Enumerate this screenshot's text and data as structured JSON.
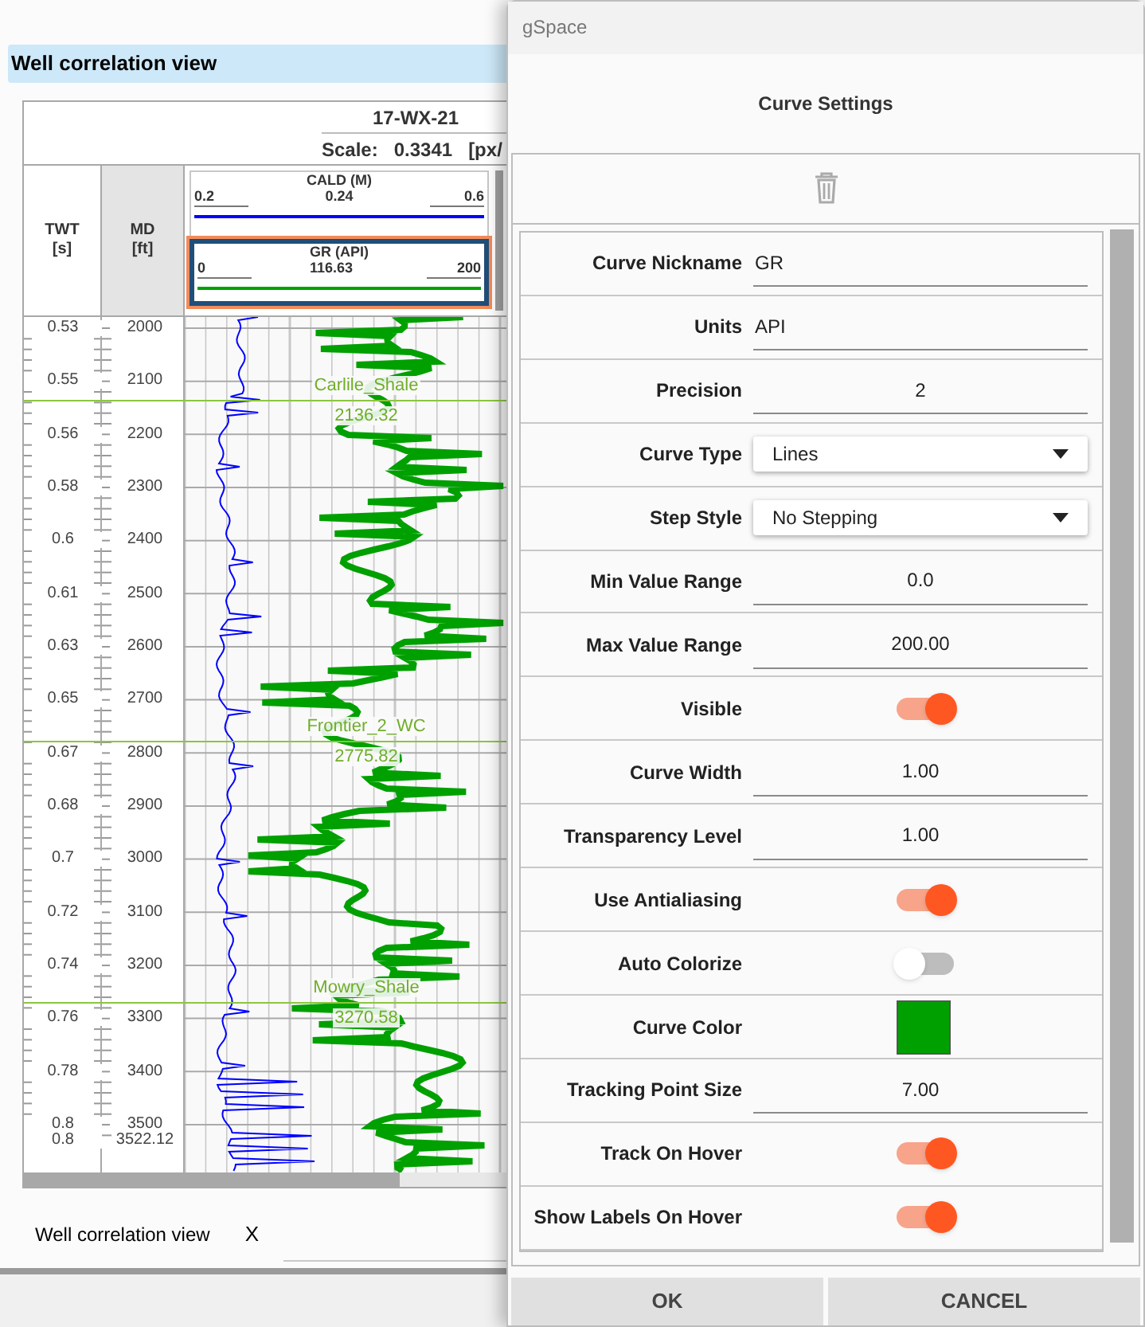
{
  "main_window": {
    "view_title": "Well correlation view",
    "well_name": "17-WX-21",
    "scale_label": "Scale:",
    "scale_value": "0.3341",
    "scale_unit": "[px/",
    "twt_header": {
      "name": "TWT",
      "unit": "[s]"
    },
    "md_header": {
      "name": "MD",
      "unit": "[ft]"
    },
    "curves": [
      {
        "name": "CALD (M)",
        "min": "0.2",
        "current": "0.24",
        "max": "0.6",
        "color": "#0000ff",
        "selected": false
      },
      {
        "name": "GR (API)",
        "min": "0",
        "current": "116.63",
        "max": "200",
        "color": "#00a000",
        "selected": true
      }
    ],
    "depth_labels": [
      {
        "twt": "0.53",
        "md": "2000"
      },
      {
        "twt": "0.55",
        "md": "2100"
      },
      {
        "twt": "0.56",
        "md": "2200"
      },
      {
        "twt": "0.58",
        "md": "2300"
      },
      {
        "twt": "0.6",
        "md": "2400"
      },
      {
        "twt": "0.61",
        "md": "2500"
      },
      {
        "twt": "0.63",
        "md": "2600"
      },
      {
        "twt": "0.65",
        "md": "2700"
      },
      {
        "twt": "0.67",
        "md": "2800"
      },
      {
        "twt": "0.68",
        "md": "2900"
      },
      {
        "twt": "0.7",
        "md": "3000"
      },
      {
        "twt": "0.72",
        "md": "3100"
      },
      {
        "twt": "0.74",
        "md": "3200"
      },
      {
        "twt": "0.76",
        "md": "3300"
      },
      {
        "twt": "0.78",
        "md": "3400"
      },
      {
        "twt": "0.8",
        "md": "3500"
      },
      {
        "twt": "0.8",
        "md": "3522.12"
      }
    ],
    "formation_tops": [
      {
        "name": "Carlile_Shale",
        "depth": "2136.32"
      },
      {
        "name": "Frontier_2_WC",
        "depth": "2775.82"
      },
      {
        "name": "Mowry_Shale",
        "depth": "3270.58"
      }
    ],
    "tabs": [
      {
        "label": "Well correlation view",
        "close": "X",
        "selected": true
      }
    ]
  },
  "dialog": {
    "app_title": "gSpace",
    "title": "Curve Settings",
    "rows": [
      {
        "kind": "text",
        "label": "Curve Nickname",
        "value": "GR"
      },
      {
        "kind": "text",
        "label": "Units",
        "value": "API"
      },
      {
        "kind": "number",
        "label": "Precision",
        "value": "2"
      },
      {
        "kind": "select",
        "label": "Curve Type",
        "value": "Lines"
      },
      {
        "kind": "select",
        "label": "Step Style",
        "value": "No Stepping"
      },
      {
        "kind": "number",
        "label": "Min Value Range",
        "value": "0.0"
      },
      {
        "kind": "number",
        "label": "Max Value Range",
        "value": "200.00"
      },
      {
        "kind": "toggle",
        "label": "Visible",
        "on": true
      },
      {
        "kind": "number",
        "label": "Curve Width",
        "value": "1.00"
      },
      {
        "kind": "number",
        "label": "Transparency Level",
        "value": "1.00"
      },
      {
        "kind": "toggle",
        "label": "Use Antialiasing",
        "on": true
      },
      {
        "kind": "toggle",
        "label": "Auto Colorize",
        "on": false
      },
      {
        "kind": "color",
        "label": "Curve Color",
        "color": "#00a000"
      },
      {
        "kind": "number",
        "label": "Tracking Point Size",
        "value": "7.00"
      },
      {
        "kind": "toggle",
        "label": "Track On Hover",
        "on": true
      },
      {
        "kind": "toggle",
        "label": "Show Labels On Hover",
        "on": true
      }
    ],
    "buttons": [
      "OK",
      "CANCEL"
    ]
  }
}
